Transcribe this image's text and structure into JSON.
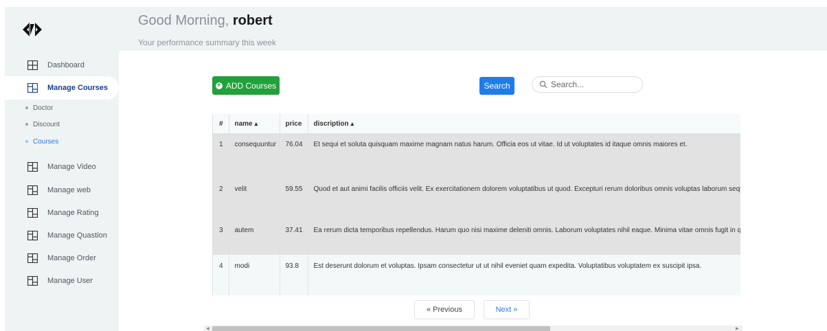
{
  "header": {
    "greeting_prefix": "Good Morning, ",
    "user_name": "robert",
    "subtitle": "Your performance summary this week"
  },
  "sidebar": {
    "items": [
      {
        "label": "Dashboard",
        "icon": "dashboard-grid-icon"
      },
      {
        "label": "Manage Courses",
        "icon": "manage-icon",
        "active": true
      },
      {
        "label": "Manage Video",
        "icon": "manage-icon"
      },
      {
        "label": "Manage web",
        "icon": "manage-icon"
      },
      {
        "label": "Manage Rating",
        "icon": "manage-icon"
      },
      {
        "label": "Manage Quastion",
        "icon": "manage-icon"
      },
      {
        "label": "Manage Order",
        "icon": "manage-icon"
      },
      {
        "label": "Manage User",
        "icon": "manage-icon"
      }
    ],
    "sub_items": [
      {
        "label": "Doctor"
      },
      {
        "label": "Discount"
      },
      {
        "label": "Courses",
        "active": true
      }
    ]
  },
  "toolbar": {
    "add_label": "ADD Courses",
    "search_button": "Search",
    "search_placeholder": "Search..."
  },
  "table": {
    "columns": [
      "#",
      "name",
      "price",
      "discription"
    ],
    "rows": [
      {
        "id": "1",
        "name": "consequuntur",
        "price": "76.04",
        "description": "Et sequi et soluta quisquam maxime magnam natus harum. Officia eos ut vitae. Id ut voluptates id itaque omnis maiores et."
      },
      {
        "id": "2",
        "name": "velit",
        "price": "59.55",
        "description": "Quod et aut animi facilis officiis velit. Ex exercitationem dolorem voluptatibus ut quod. Excepturi rerum doloribus omnis voluptas laborum sequi et. Ut et ei"
      },
      {
        "id": "3",
        "name": "autem",
        "price": "37.41",
        "description": "Ea rerum dicta temporibus repellendus. Harum quo nisi maxime deleniti omnis. Laborum voluptates nihil eaque. Minima vitae omnis fugit in qui odit animi."
      },
      {
        "id": "4",
        "name": "modi",
        "price": "93.8",
        "description": "Est deserunt dolorum et voluptas. Ipsam consectetur ut ut nihil eveniet quam expedita. Voluptatibus voluptatem ex suscipit ipsa."
      }
    ]
  },
  "pagination": {
    "previous": "« Previous",
    "next": "Next »"
  },
  "colors": {
    "add_button": "#22a03a",
    "search_button": "#1f7de9",
    "sidebar_bg": "#eef3f3",
    "active_text": "#1a3d8f"
  }
}
